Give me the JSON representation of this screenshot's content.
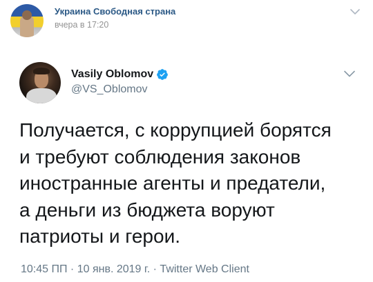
{
  "vk_post": {
    "group_name": "Украина Свободная страна",
    "time": "вчера в 17:20",
    "menu_icon": "chevron-down-icon"
  },
  "tweet": {
    "author_name": "Vasily Oblomov",
    "verified_icon": "verified-badge-icon",
    "handle": "@VS_Oblomov",
    "menu_icon": "chevron-down-icon",
    "text_lines": [
      "Получается, с коррупцией борятся",
      "и требуют соблюдения законов",
      "иностранные агенты и предатели,",
      "а деньги из бюджета воруют",
      "патриоты и герои."
    ],
    "meta": "10:45 ПП · 10 янв. 2019 г. · Twitter Web Client"
  },
  "colors": {
    "vk_link": "#2a5885",
    "vk_time": "#939393",
    "twitter_text": "#14171a",
    "twitter_secondary": "#657786",
    "twitter_verified": "#1da1f2"
  }
}
